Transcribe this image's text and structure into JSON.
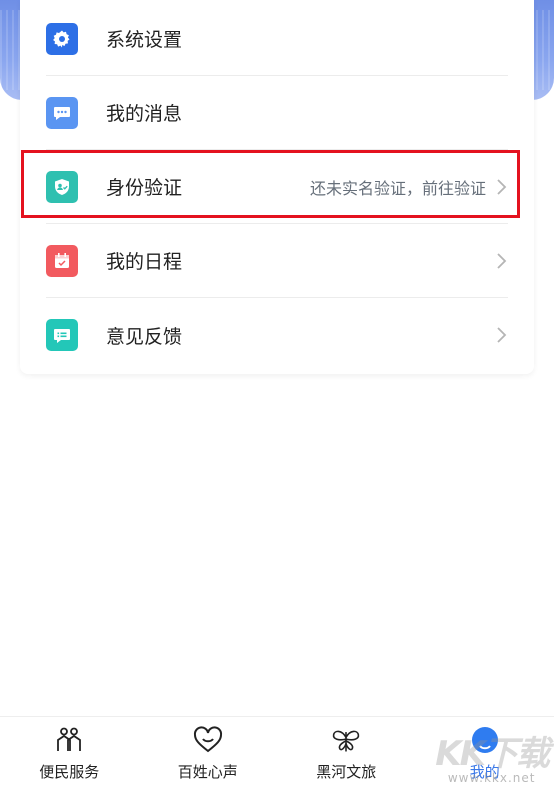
{
  "menu": {
    "items": [
      {
        "label": "系统设置",
        "icon": "gear-icon",
        "color": "#2d6fe6",
        "hint": "",
        "chevron": false
      },
      {
        "label": "我的消息",
        "icon": "message-icon",
        "color": "#5a95f2",
        "hint": "",
        "chevron": false
      },
      {
        "label": "身份验证",
        "icon": "id-shield-icon",
        "color": "#2fc0b0",
        "hint": "还未实名验证，前往验证",
        "chevron": true
      },
      {
        "label": "我的日程",
        "icon": "calendar-icon",
        "color": "#f25a5f",
        "hint": "",
        "chevron": true
      },
      {
        "label": "意见反馈",
        "icon": "feedback-icon",
        "color": "#23c7b8",
        "hint": "",
        "chevron": true
      }
    ]
  },
  "tabbar": {
    "tabs": [
      {
        "label": "便民服务",
        "icon": "people-icon",
        "active": false
      },
      {
        "label": "百姓心声",
        "icon": "heart-icon",
        "active": false
      },
      {
        "label": "黑河文旅",
        "icon": "butterfly-icon",
        "active": false
      },
      {
        "label": "我的",
        "icon": "me-icon",
        "active": true
      }
    ],
    "active_color": "#3a78e8"
  },
  "watermark": {
    "text": "KK下载",
    "url": "www.kkx.net"
  },
  "colors": {
    "highlight": "#e4121f",
    "header": "#7c98eb"
  }
}
